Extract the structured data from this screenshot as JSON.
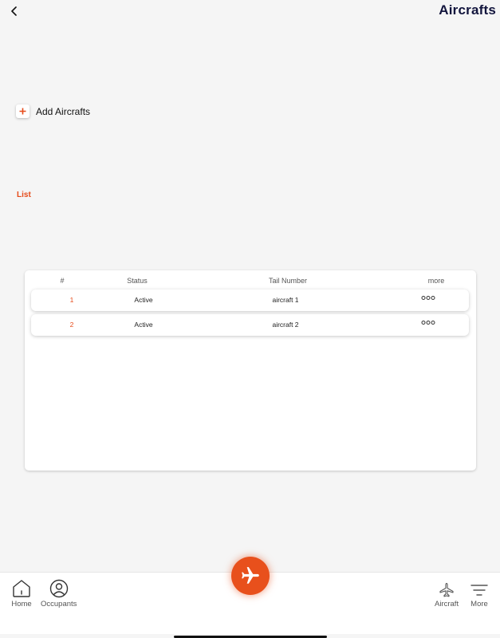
{
  "header": {
    "title": "Aircrafts"
  },
  "actions": {
    "add_label": "Add Aircrafts"
  },
  "section": {
    "list_label": "List"
  },
  "table": {
    "columns": [
      "#",
      "Status",
      "Tail Number",
      "more"
    ],
    "rows": [
      {
        "index": "1",
        "status": "Active",
        "tail_number": "aircraft 1"
      },
      {
        "index": "2",
        "status": "Active",
        "tail_number": "aircraft 2"
      }
    ]
  },
  "bottom_nav": {
    "home": "Home",
    "occupants": "Occupants",
    "aircraft": "Aircraft",
    "more": "More"
  },
  "icons": [
    "back-chevron-icon",
    "plus-icon",
    "more-dots-icon",
    "home-icon",
    "user-circle-icon",
    "airplane-icon",
    "menu-lines-icon"
  ],
  "colors": {
    "accent": "#e64a19",
    "fab": "#e8501c",
    "title": "#12153d",
    "background": "#f5f5f5"
  }
}
